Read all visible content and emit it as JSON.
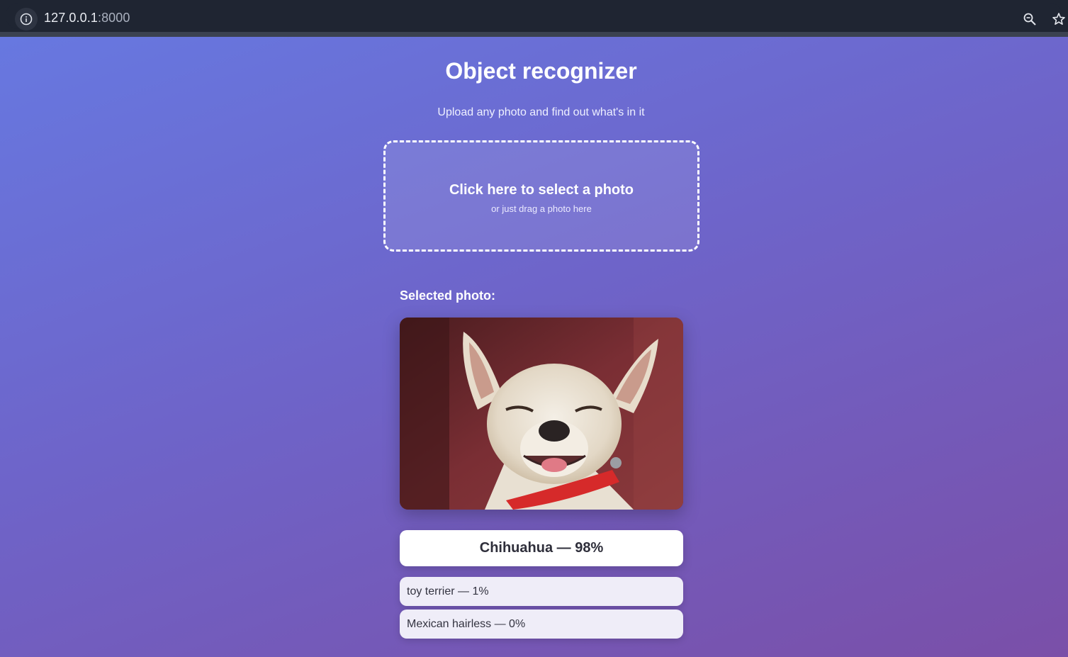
{
  "browser": {
    "url_host": "127.0.0.1",
    "url_port": ":8000",
    "icons": [
      "info-icon",
      "zoom-icon",
      "star-icon"
    ]
  },
  "page": {
    "title": "Object recognizer",
    "subtitle": "Upload any photo and find out what's in it",
    "dropzone": {
      "main_label": "Click here to select a photo",
      "sub_label": "or just drag a photo here"
    },
    "selected_label": "Selected photo:",
    "results": {
      "top": "Chihuahua — 98%",
      "others": [
        "toy terrier — 1%",
        "Mexican hairless — 0%"
      ]
    }
  },
  "colors": {
    "gradient_start": "#6778e0",
    "gradient_end": "#7a4fa8",
    "browser_bar": "#1f2532"
  }
}
